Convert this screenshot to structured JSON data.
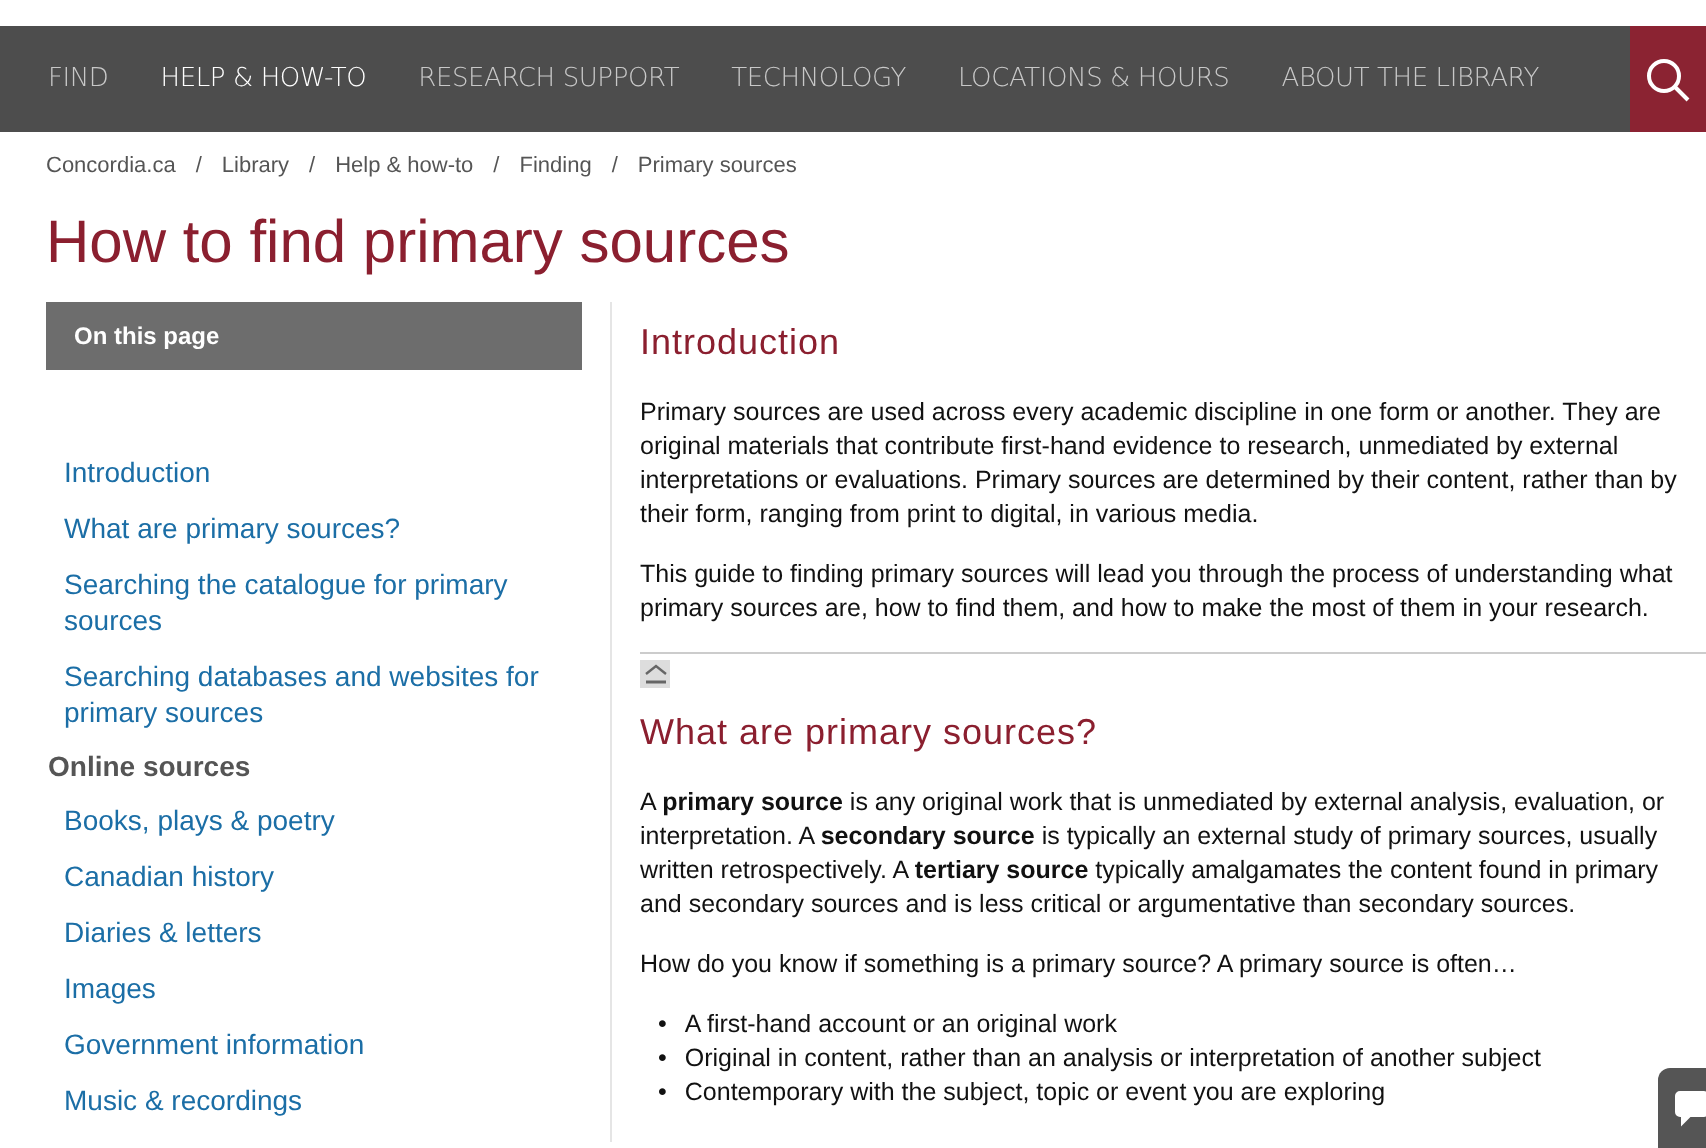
{
  "nav": {
    "items": [
      {
        "label": "FIND",
        "selected": false
      },
      {
        "label": "HELP & HOW-TO",
        "selected": true
      },
      {
        "label": "RESEARCH SUPPORT",
        "selected": false
      },
      {
        "label": "TECHNOLOGY",
        "selected": false
      },
      {
        "label": "LOCATIONS & HOURS",
        "selected": false
      },
      {
        "label": "ABOUT THE LIBRARY",
        "selected": false
      }
    ]
  },
  "breadcrumb": [
    "Concordia.ca",
    "Library",
    "Help & how-to",
    "Finding",
    "Primary sources"
  ],
  "breadcrumb_separator": "/",
  "page_title": "How to find primary sources",
  "sidebar": {
    "heading": "On this page",
    "items": [
      {
        "kind": "link",
        "label": "Introduction"
      },
      {
        "kind": "link",
        "label": "What are primary sources?"
      },
      {
        "kind": "link",
        "label": "Searching the catalogue for primary sources"
      },
      {
        "kind": "link",
        "label": "Searching databases and websites for primary sources"
      },
      {
        "kind": "heading",
        "label": "Online sources"
      },
      {
        "kind": "link",
        "label": "Books, plays & poetry"
      },
      {
        "kind": "link",
        "label": "Canadian history"
      },
      {
        "kind": "link",
        "label": "Diaries & letters"
      },
      {
        "kind": "link",
        "label": "Images"
      },
      {
        "kind": "link",
        "label": "Government information"
      },
      {
        "kind": "link",
        "label": "Music & recordings"
      }
    ]
  },
  "sections": [
    {
      "heading": "Introduction",
      "blocks": [
        {
          "kind": "paragraph",
          "text": "Primary sources are used across every academic discipline in one form or another. They are original materials that contribute first-hand evidence to research, unmediated by external interpretations or evaluations. Primary sources are determined by their content, rather than by their form, ranging from print to digital, in various media."
        },
        {
          "kind": "paragraph",
          "text": "This guide to finding primary sources will lead you through the process of understanding what primary sources are, how to find them, and how to make the most of them in your research."
        },
        {
          "kind": "back_to_top"
        }
      ]
    },
    {
      "heading": "What are primary sources?",
      "blocks": [
        {
          "kind": "paragraph",
          "text": "A **primary source** is any original work that is unmediated by external analysis, evaluation, or interpretation. A **secondary source** is typically an external study of primary sources, usually written retrospectively. A **tertiary source** typically amalgamates the content found in primary and secondary sources and is less critical or argumentative than secondary sources."
        },
        {
          "kind": "paragraph",
          "text": "How do you know if something is a primary source? A primary source is often…"
        },
        {
          "kind": "list",
          "marker": "•",
          "items": [
            "A first-hand account or an original work",
            "Original in content, rather than an analysis or interpretation of another subject",
            "Contemporary with the subject, topic or event you are exploring"
          ]
        }
      ]
    }
  ]
}
